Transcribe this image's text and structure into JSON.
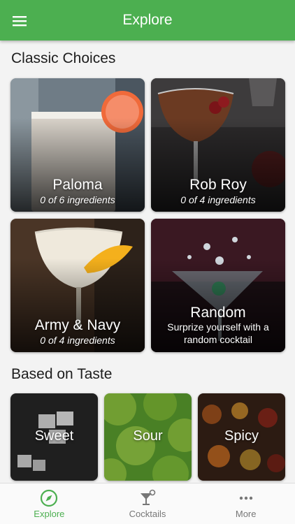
{
  "header": {
    "title": "Explore",
    "menu_icon": "hamburger-menu-icon"
  },
  "sections": {
    "classic": "Classic Choices",
    "taste": "Based on Taste"
  },
  "classic_cards": [
    {
      "name": "Paloma",
      "subtitle": "0 of 6 ingredients"
    },
    {
      "name": "Rob Roy",
      "subtitle": "0 of 4 ingredients"
    },
    {
      "name": "Army & Navy",
      "subtitle": "0 of 4 ingredients"
    },
    {
      "name": "Random",
      "subtitle": "Surprize yourself with a random cocktail"
    }
  ],
  "taste_cards": [
    {
      "name": "Sweet"
    },
    {
      "name": "Sour"
    },
    {
      "name": "Spicy"
    }
  ],
  "bottom_nav": [
    {
      "label": "Explore",
      "icon": "compass-icon",
      "active": true
    },
    {
      "label": "Cocktails",
      "icon": "cocktail-glass-icon",
      "active": false
    },
    {
      "label": "More",
      "icon": "more-dots-icon",
      "active": false
    }
  ],
  "colors": {
    "primary": "#4caf50",
    "inactive": "#777777"
  }
}
